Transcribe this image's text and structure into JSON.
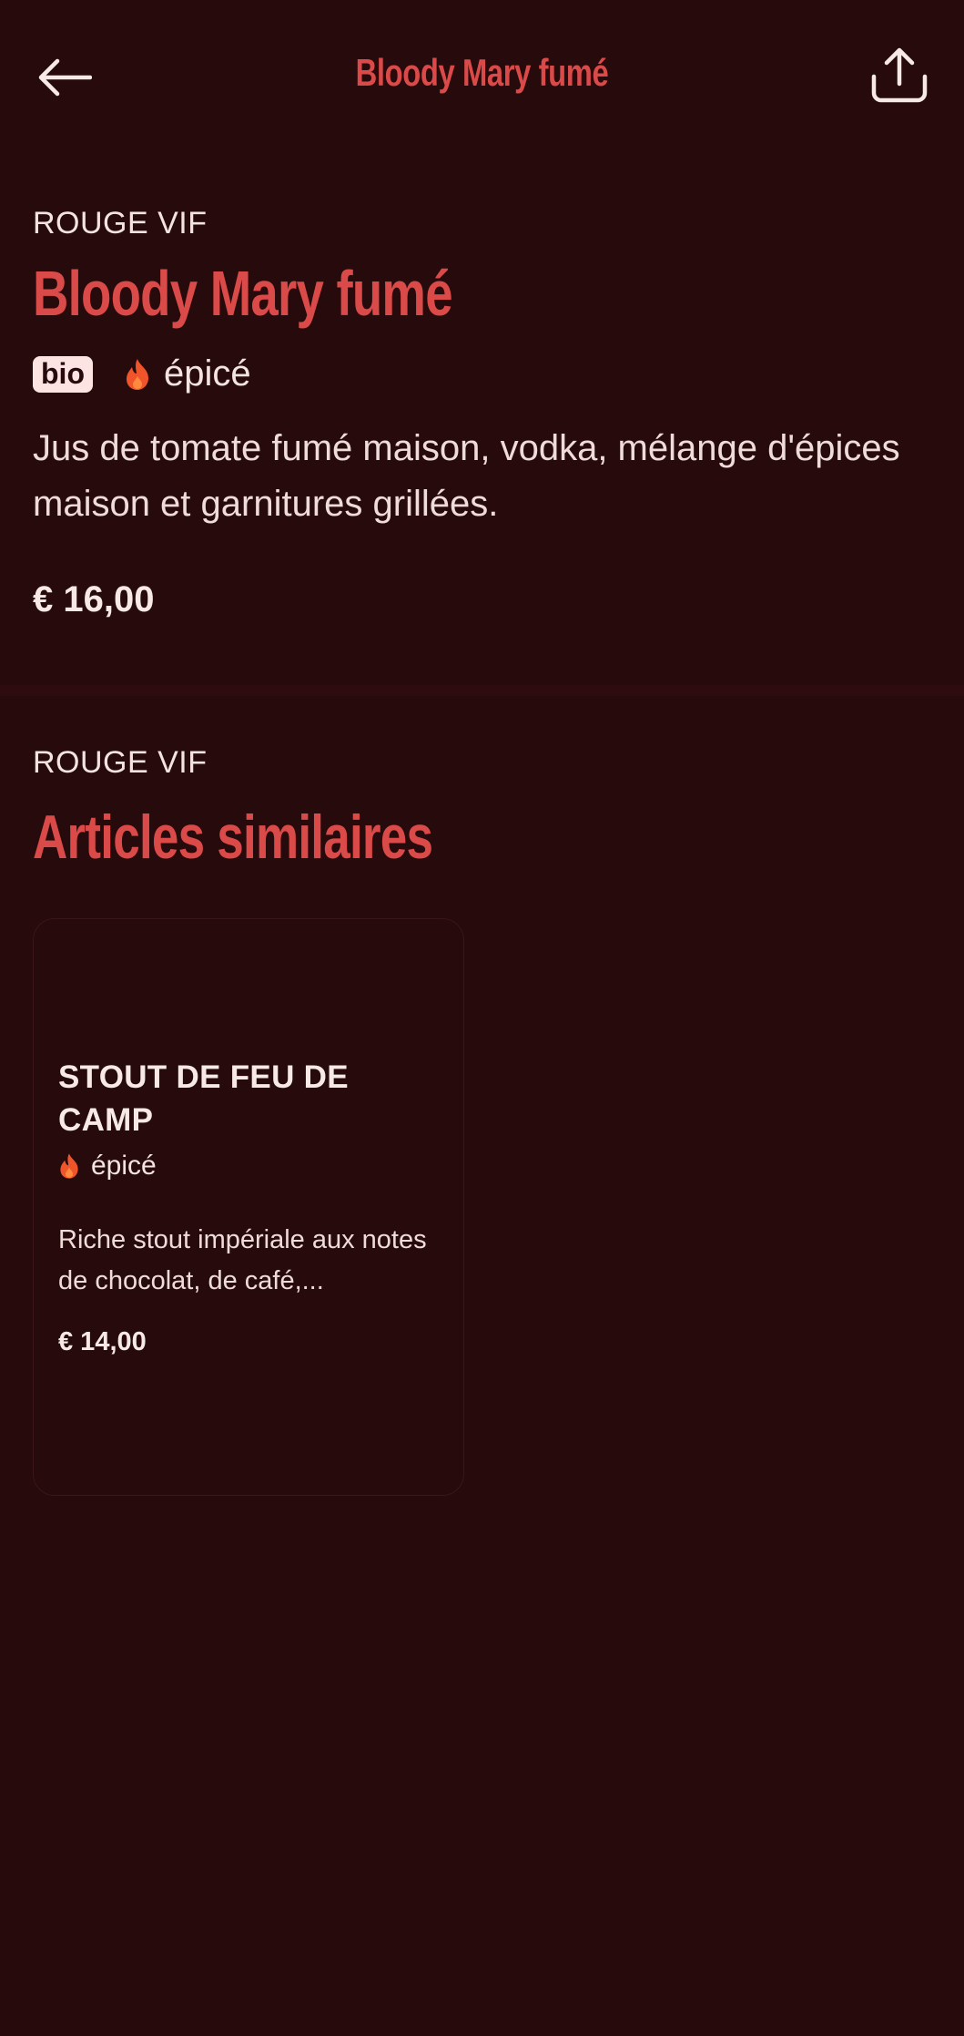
{
  "header": {
    "title": "Bloody Mary fumé",
    "back_icon": "arrow-left-icon",
    "share_icon": "share-icon"
  },
  "item": {
    "category": "ROUGE VIF",
    "name": "Bloody Mary fumé",
    "badge": "bio",
    "spicy_label": "épicé",
    "description": "Jus de tomate fumé maison, vodka, mélange d'épices maison et garnitures grillées.",
    "price": "€ 16,00"
  },
  "similar": {
    "category": "ROUGE VIF",
    "title": "Articles similaires",
    "items": [
      {
        "name": "STOUT DE FEU DE CAMP",
        "spicy_label": "épicé",
        "description": "Riche stout impériale aux notes de chocolat, de café,...",
        "price": "€ 14,00"
      }
    ]
  },
  "colors": {
    "background": "#270a0c",
    "accent": "#d94a48",
    "flame": "#f0542a",
    "text": "#f3e4e1"
  }
}
